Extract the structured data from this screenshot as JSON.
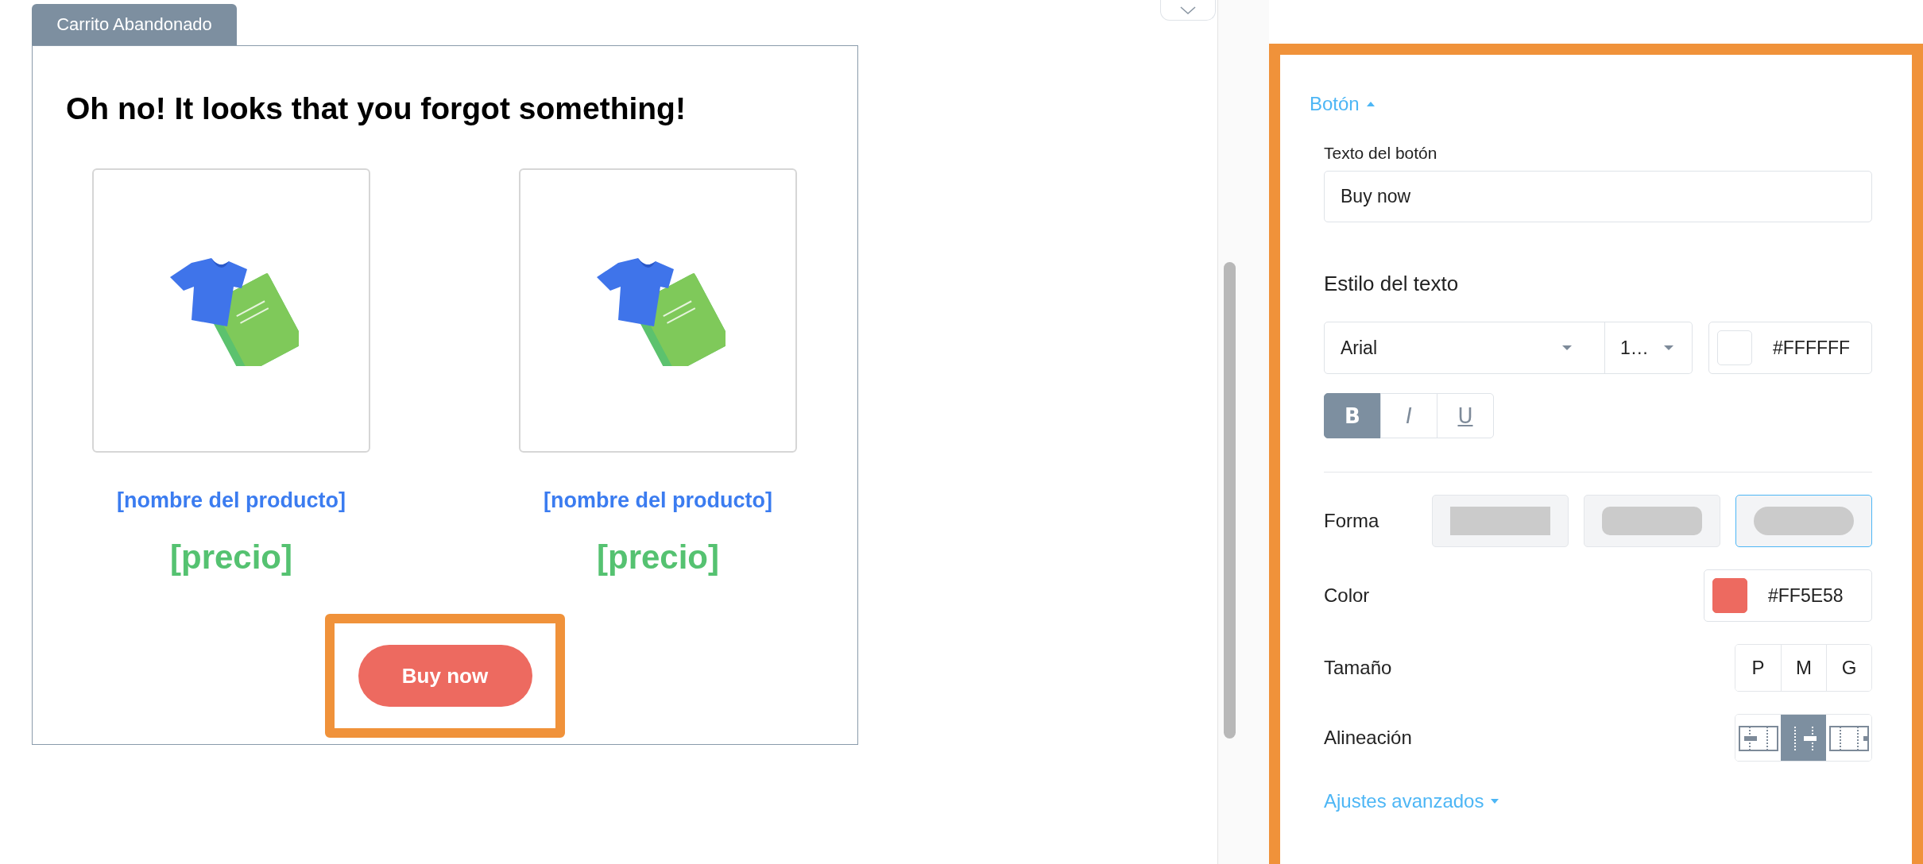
{
  "email": {
    "tab": "Carrito Abandonado",
    "heading": "Oh no! It looks that you forgot something!",
    "products": [
      {
        "name": "[nombre del producto]",
        "price": "[precio]"
      },
      {
        "name": "[nombre del producto]",
        "price": "[precio]"
      }
    ],
    "button": {
      "label": "Buy now",
      "selected": true
    }
  },
  "panel": {
    "section": {
      "title": "Botón",
      "expanded": true
    },
    "text_label": "Texto del botón",
    "text_value": "Buy now",
    "style_heading": "Estilo del texto",
    "font": "Arial",
    "font_size": "1…",
    "text_color": {
      "color": "#ffffff",
      "value": "#FFFFFF"
    },
    "format": [
      {
        "label": "B",
        "kind": "bold",
        "selected": true
      },
      {
        "label": "I",
        "kind": "italic",
        "selected": false
      },
      {
        "label": "U",
        "kind": "underline",
        "selected": false
      }
    ],
    "shape": {
      "label": "Forma",
      "options": [
        {
          "kind": "square",
          "selected": false
        },
        {
          "kind": "rounded",
          "selected": false
        },
        {
          "kind": "pill",
          "selected": true
        }
      ]
    },
    "color": {
      "label": "Color",
      "color": "#ed6a60",
      "value": "#FF5E58"
    },
    "size": {
      "label": "Tamaño",
      "options": [
        {
          "label": "P",
          "selected": false
        },
        {
          "label": "M",
          "selected": false
        },
        {
          "label": "G",
          "selected": false
        }
      ]
    },
    "align": {
      "label": "Alineación",
      "options": [
        {
          "kind": "left",
          "selected": false
        },
        {
          "kind": "center",
          "selected": true
        },
        {
          "kind": "right",
          "selected": false
        }
      ]
    },
    "advanced": {
      "label": "Ajustes avanzados",
      "expanded": false
    }
  }
}
